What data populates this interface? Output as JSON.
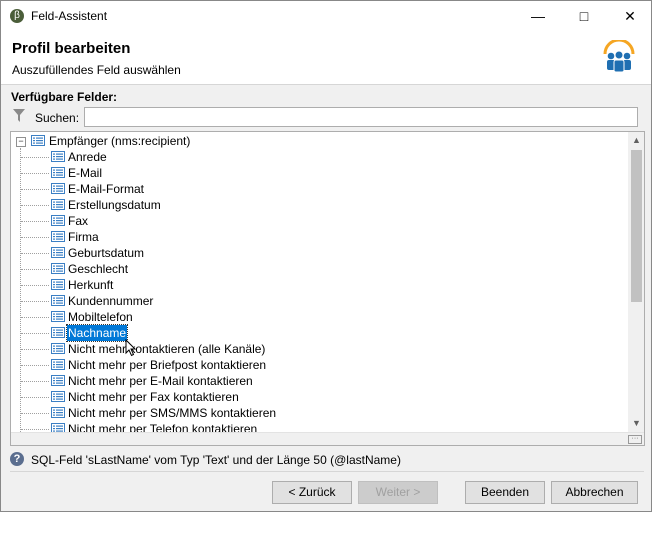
{
  "window": {
    "title": "Feld-Assistent"
  },
  "header": {
    "title": "Profil bearbeiten",
    "subtitle": "Auszufüllendes Feld auswählen"
  },
  "fields_label": "Verfügbare Felder:",
  "search": {
    "label": "Suchen:",
    "value": ""
  },
  "tree": {
    "root": "Empfänger (nms:recipient)",
    "items": [
      "Anrede",
      "E-Mail",
      "E-Mail-Format",
      "Erstellungsdatum",
      "Fax",
      "Firma",
      "Geburtsdatum",
      "Geschlecht",
      "Herkunft",
      "Kundennummer",
      "Mobiltelefon",
      "Nachname",
      "Nicht mehr kontaktieren (alle Kanäle)",
      "Nicht mehr per Briefpost kontaktieren",
      "Nicht mehr per E-Mail kontaktieren",
      "Nicht mehr per Fax kontaktieren",
      "Nicht mehr per SMS/MMS kontaktieren",
      "Nicht mehr per Telefon kontaktieren"
    ],
    "selected": "Nachname"
  },
  "info": "SQL-Feld 'sLastName' vom Typ 'Text' und der Länge 50 (@lastName)",
  "buttons": {
    "back": "< Zurück",
    "next": "Weiter >",
    "finish": "Beenden",
    "cancel": "Abbrechen"
  },
  "colors": {
    "selection": "#0078d7",
    "accent": "#f5a623",
    "people_blue": "#1f6fb2"
  }
}
